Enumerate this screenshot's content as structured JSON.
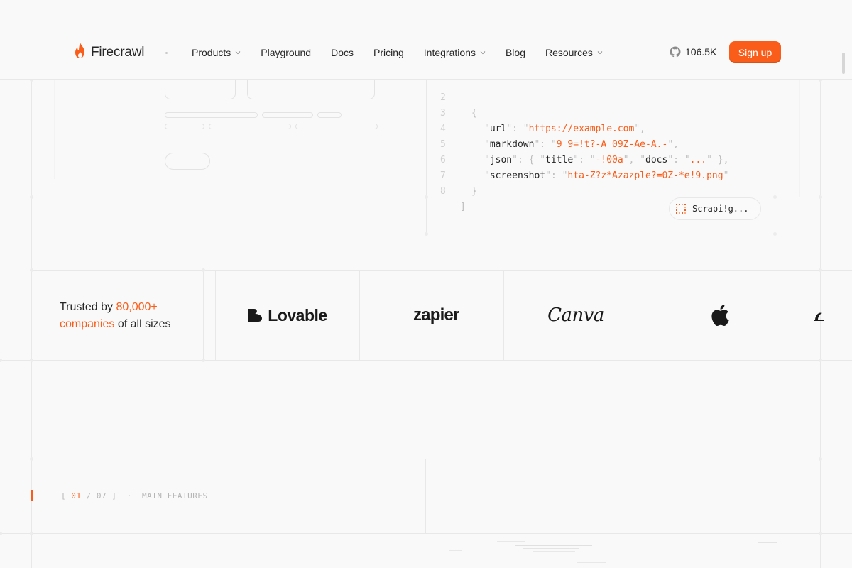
{
  "brand": {
    "name": "Firecrawl",
    "accent_color": "#fa5d19"
  },
  "nav": {
    "items": [
      {
        "label": "Products",
        "has_dropdown": true
      },
      {
        "label": "Playground",
        "has_dropdown": false
      },
      {
        "label": "Docs",
        "has_dropdown": false
      },
      {
        "label": "Pricing",
        "has_dropdown": false
      },
      {
        "label": "Integrations",
        "has_dropdown": true
      },
      {
        "label": "Blog",
        "has_dropdown": false
      },
      {
        "label": "Resources",
        "has_dropdown": true
      }
    ],
    "github_stars": "106.5K",
    "signup_label": "Sign up"
  },
  "code": {
    "lines": [
      {
        "n": "2",
        "text": "{"
      },
      {
        "n": "3",
        "key": "url",
        "value": "https://example.com"
      },
      {
        "n": "4",
        "key": "markdown",
        "value": "9 9=!t?-A 09Z-Ae-A.-"
      },
      {
        "n": "5",
        "key": "json",
        "sub_key1": "title",
        "sub_val1": "-!00a",
        "sub_key2": "docs",
        "sub_val2": "..."
      },
      {
        "n": "6",
        "key": "screenshot",
        "value": "hta-Z?z*Azazple?=0Z-*e!9.png"
      },
      {
        "n": "7",
        "text": "}"
      },
      {
        "n": "8",
        "text": "]"
      }
    ],
    "status_label": "Scrapi!g..."
  },
  "trusted": {
    "prefix": "Trusted by",
    "highlight1": "80,000+",
    "highlight2": "companies",
    "suffix": "of all sizes"
  },
  "logos": [
    {
      "name": "Lovable",
      "icon": "lovable-heart-icon"
    },
    {
      "name": "_zapier",
      "icon": "zapier-wordmark"
    },
    {
      "name": "Canva",
      "icon": "canva-wordmark"
    },
    {
      "name": "Apple",
      "icon": "apple-icon"
    }
  ],
  "features": {
    "bracket_open": "[",
    "current": "01",
    "slash": "/",
    "total": "07",
    "bracket_close": "]",
    "dot": "·",
    "label": "MAIN FEATURES"
  }
}
